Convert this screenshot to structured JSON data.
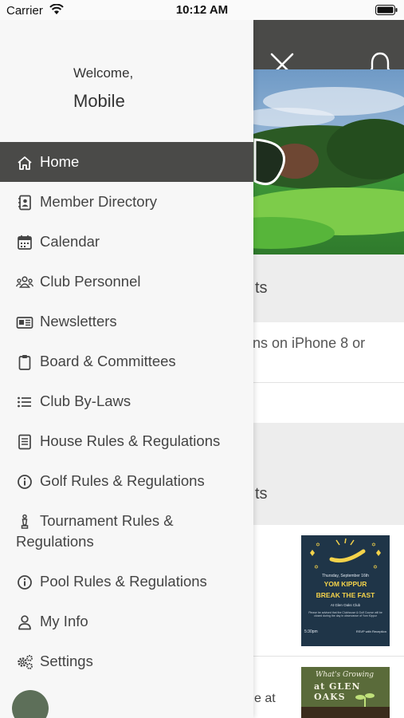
{
  "status_bar": {
    "carrier": "Carrier",
    "time": "10:12 AM"
  },
  "drawer": {
    "welcome": "Welcome,",
    "username": "Mobile",
    "items": [
      {
        "label": "Home",
        "icon": "home-icon",
        "active": true
      },
      {
        "label": "Member Directory",
        "icon": "contact-book-icon"
      },
      {
        "label": "Calendar",
        "icon": "calendar-icon"
      },
      {
        "label": "Club Personnel",
        "icon": "people-icon"
      },
      {
        "label": "Newsletters",
        "icon": "newspaper-icon"
      },
      {
        "label": "Board & Committees",
        "icon": "clipboard-icon"
      },
      {
        "label": "Club By-Laws",
        "icon": "list-icon"
      },
      {
        "label": "House Rules & Regulations",
        "icon": "document-icon"
      },
      {
        "label": "Golf Rules & Regulations",
        "icon": "info-icon"
      },
      {
        "label": "Tournament Rules & Regulations",
        "icon": "chess-piece-icon"
      },
      {
        "label": "Pool Rules & Regulations",
        "icon": "info-icon"
      },
      {
        "label": "My Info",
        "icon": "user-icon"
      },
      {
        "label": "Settings",
        "icon": "gears-icon"
      }
    ]
  },
  "background": {
    "section1_tail": "ts",
    "notice_tail": "ns on iPhone 8 or",
    "section2_tail": "ts",
    "news_tail": "e at",
    "flyer1": {
      "date": "Thursday, September 16th",
      "title1": "YOM KIPPUR",
      "title2": "BREAK THE FAST",
      "venue": "At Glen Oaks Club",
      "body": "Please be advised that the Clubhouse & Golf Course will be closed during the day in observance of Yom Kippur",
      "time": "5:30pm",
      "rsvp": "RSVP with Reception"
    },
    "flyer2": {
      "title1": "What's Growing",
      "title2": "at GLEN OAKS"
    }
  },
  "colors": {
    "header": "#4a4a48",
    "drawer": "#f7f7f7",
    "active": "#4a4a48",
    "fab": "#5d6f59"
  }
}
